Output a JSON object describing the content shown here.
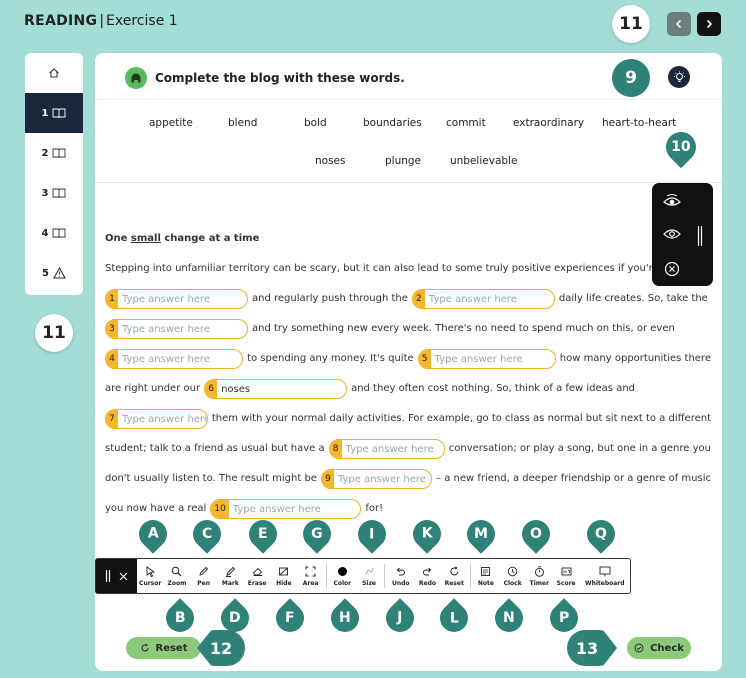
{
  "header": {
    "section": "READING",
    "separator": "|",
    "exercise": "Exercise 1"
  },
  "nav": {
    "badge": "11"
  },
  "sidebar": {
    "items": [
      {
        "label": "",
        "icon": "home-icon"
      },
      {
        "label": "1",
        "icon": "book-icon"
      },
      {
        "label": "2",
        "icon": "book-icon"
      },
      {
        "label": "3",
        "icon": "book-icon"
      },
      {
        "label": "4",
        "icon": "book-icon"
      },
      {
        "label": "5",
        "icon": "warning-icon"
      }
    ],
    "badge": "11"
  },
  "instruction": "Complete the blog with these words.",
  "hint_badge": "9",
  "visibility_badge": "10",
  "word_bank": [
    "appetite",
    "blend",
    "bold",
    "boundaries",
    "commit",
    "extraordinary",
    "heart-to-heart",
    "noses",
    "plunge",
    "unbelievable"
  ],
  "passage": {
    "title_pre": "One ",
    "title_underlined": "small",
    "title_post": " change at a time",
    "line1": "Stepping into unfamiliar territory can be scary, but it can also lead to some truly positive experiences if you're",
    "t1": "and regularly push through the",
    "t2": "daily life creates. So, take the",
    "t3": "and try something new every week. There's no need to spend much on this, or even",
    "t4": "to spending any money. It's quite",
    "t5": "how many opportunities there",
    "t6": "are right under our",
    "t7": "and they often cost nothing. So, think of a few ideas and",
    "t8": "them with your normal daily activities. For example, go to class as normal but sit next to a different",
    "t9": "student; talk to a friend as usual but have a",
    "t10": "conversation; or play a song, but one in a genre you",
    "t11": "don't usually listen to. The result might be",
    "t12": "– a new friend, a deeper friendship or a genre of music",
    "t13": "you now have a real",
    "t14": "for!"
  },
  "gaps": [
    {
      "num": "1",
      "value": "",
      "placeholder": "Type answer here"
    },
    {
      "num": "2",
      "value": "",
      "placeholder": "Type answer here"
    },
    {
      "num": "3",
      "value": "",
      "placeholder": "Type answer here"
    },
    {
      "num": "4",
      "value": "",
      "placeholder": "Type answer here"
    },
    {
      "num": "5",
      "value": "",
      "placeholder": "Type answer here"
    },
    {
      "num": "6",
      "value": "noses",
      "placeholder": ""
    },
    {
      "num": "7",
      "value": "",
      "placeholder": "Type answer here"
    },
    {
      "num": "8",
      "value": "",
      "placeholder": "Type answer here"
    },
    {
      "num": "9",
      "value": "",
      "placeholder": "Type answer here"
    },
    {
      "num": "10",
      "value": "",
      "placeholder": "Type answer here"
    }
  ],
  "toolbar": {
    "tools": [
      {
        "label": "Cursor",
        "letter": "A"
      },
      {
        "label": "Zoom",
        "letter": "B"
      },
      {
        "label": "Pen",
        "letter": "C"
      },
      {
        "label": "Mark",
        "letter": "D"
      },
      {
        "label": "Erase",
        "letter": "E"
      },
      {
        "label": "Hide",
        "letter": "F"
      },
      {
        "label": "Area",
        "letter": "G"
      },
      {
        "label": "Color",
        "letter": "H"
      },
      {
        "label": "Size",
        "letter": "I"
      },
      {
        "label": "Undo",
        "letter": "J"
      },
      {
        "label": "Redo",
        "letter": "K"
      },
      {
        "label": "Reset",
        "letter": "L"
      },
      {
        "label": "Note",
        "letter": "M"
      },
      {
        "label": "Clock",
        "letter": "N"
      },
      {
        "label": "Timer",
        "letter": "O"
      },
      {
        "label": "Score",
        "letter": "P"
      },
      {
        "label": "Whiteboard",
        "letter": "Q"
      }
    ]
  },
  "buttons": {
    "reset": "Reset",
    "reset_badge": "12",
    "check": "Check",
    "check_badge": "13"
  },
  "colors": {
    "accent": "#2f8277",
    "gap": "#f7b52c",
    "dark": "#19283a",
    "bg": "#a3ddd6"
  }
}
